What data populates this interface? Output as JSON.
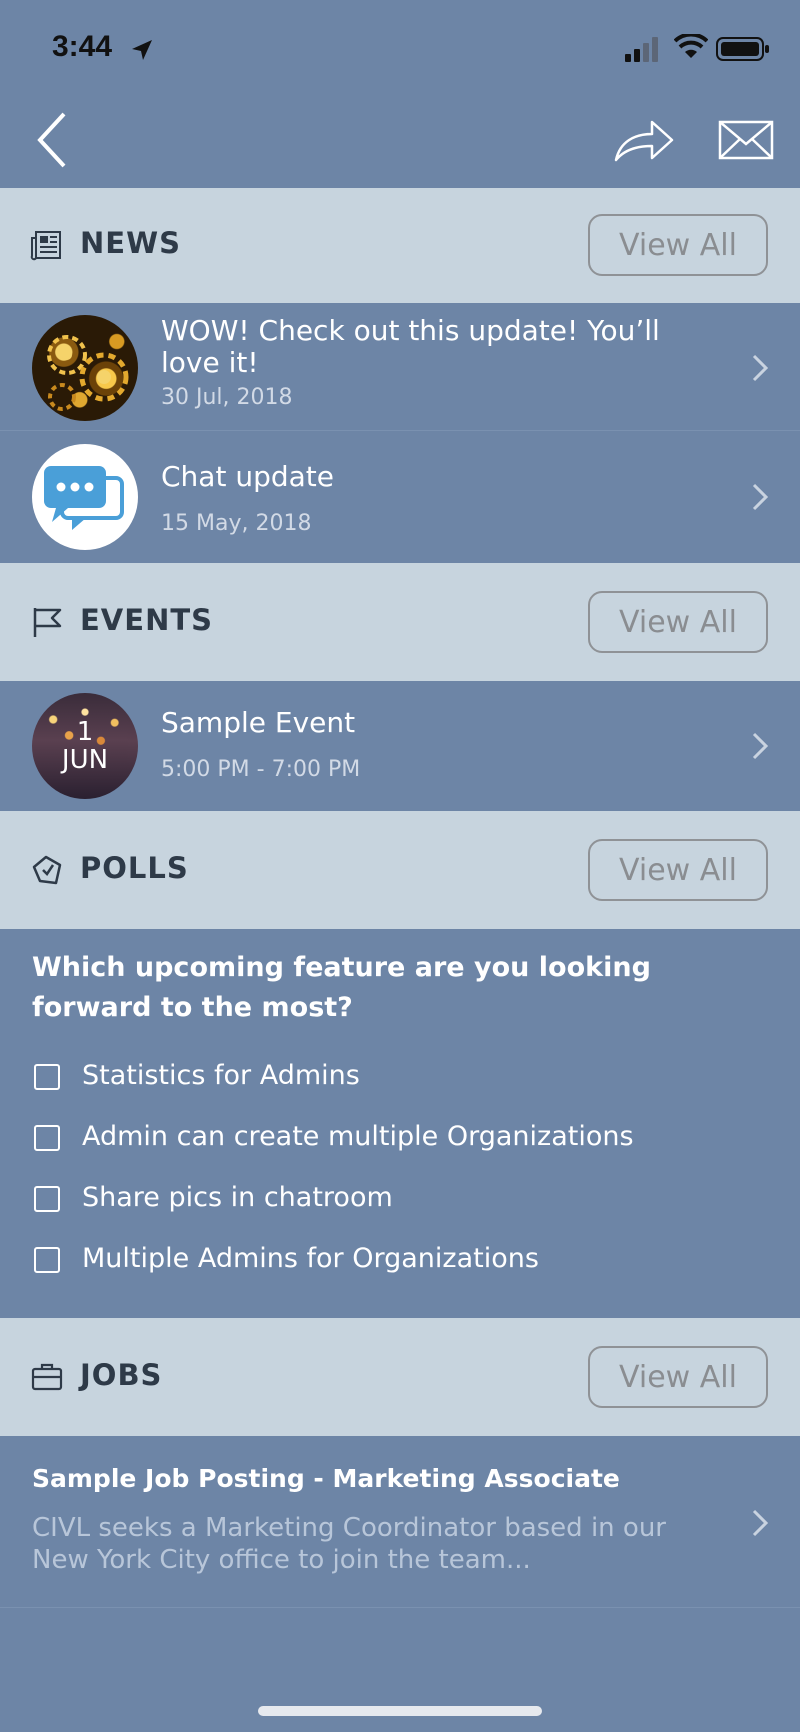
{
  "status_bar": {
    "time": "3:44",
    "icons": [
      "location-arrow-icon",
      "signal-icon",
      "wifi-icon",
      "battery-icon"
    ]
  },
  "nav": {
    "icons": [
      "back-icon",
      "share-icon",
      "mail-icon"
    ]
  },
  "colors": {
    "background": "#6d85a6",
    "section_header": "#c7d4de",
    "section_title": "#2e3a48",
    "view_all_border": "#8f9296",
    "subtext": "#d2dae6"
  },
  "news": {
    "title": "NEWS",
    "view_all": "View All",
    "icon": "newspaper-icon",
    "items": [
      {
        "title": "WOW! Check out this update! You’ll love it!",
        "date": "30 Jul, 2018",
        "thumb": "gears-image"
      },
      {
        "title": "Chat update",
        "date": "15 May, 2018",
        "thumb": "chat-bubbles-icon"
      }
    ]
  },
  "events": {
    "title": "EVENTS",
    "view_all": "View All",
    "icon": "flag-icon",
    "items": [
      {
        "day": "1",
        "month": "JUN",
        "title": "Sample Event",
        "time": "5:00 PM - 7:00 PM"
      }
    ]
  },
  "polls": {
    "title": "POLLS",
    "view_all": "View All",
    "icon": "poll-tag-icon",
    "question": "Which upcoming feature are you looking forward to the most?",
    "options": [
      "Statistics for Admins",
      "Admin can create multiple Organizations",
      "Share pics in chatroom",
      "Multiple Admins for Organizations"
    ]
  },
  "jobs": {
    "title": "JOBS",
    "view_all": "View All",
    "icon": "briefcase-icon",
    "items": [
      {
        "title": "Sample Job Posting - Marketing Associate",
        "description": "CIVL seeks a Marketing Coordinator based in our New York City office to join the team..."
      }
    ]
  }
}
